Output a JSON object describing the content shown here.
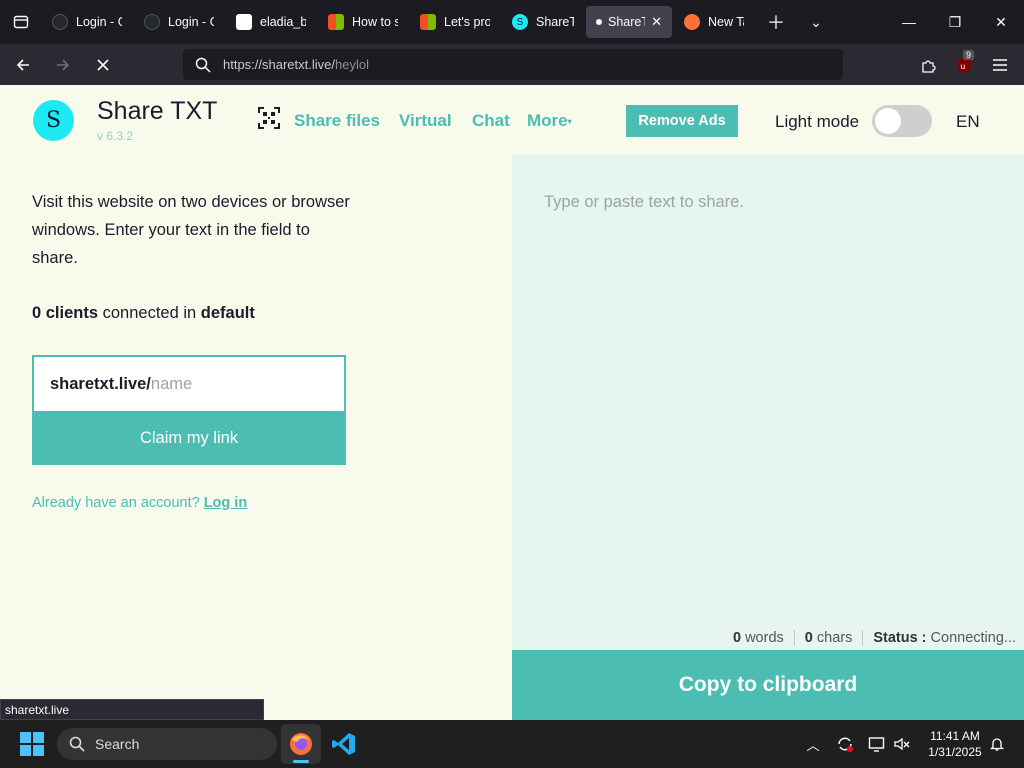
{
  "browser": {
    "tabs": [
      {
        "label": "Login - GitHub",
        "favicon": "github-icon",
        "color": "#24292e"
      },
      {
        "label": "Login - GitHub",
        "favicon": "github-icon",
        "color": "#24292e"
      },
      {
        "label": "eladia_bl",
        "favicon": "doc-icon",
        "color": "#ffffff"
      },
      {
        "label": "How to s",
        "favicon": "microsoft-icon",
        "color": "#f25022"
      },
      {
        "label": "Let's prot",
        "favicon": "microsoft-icon",
        "color": "#f25022"
      },
      {
        "label": "ShareTXT",
        "favicon": "sharetxt-icon",
        "color": "#1de9f2"
      },
      {
        "label": "ShareTXT",
        "favicon": "loading-dot-icon",
        "color": "#fbfbfe"
      },
      {
        "label": "New Tab",
        "favicon": "firefox-icon",
        "color": "#ff7139"
      }
    ],
    "url_prefix": "https://sharetxt.live/",
    "url_path": "heylol",
    "extensions_badge": "9"
  },
  "site": {
    "title": "Share TXT",
    "version": "v 6.3.2",
    "nav": [
      "Share files",
      "Virtual",
      "Chat",
      "More"
    ],
    "remove_ads": "Remove Ads",
    "light_mode_label": "Light mode",
    "light_mode_on": false,
    "language": "EN"
  },
  "left": {
    "intro": "Visit this website on two devices or browser windows. Enter your text in the field to share.",
    "clients_count": "0 clients",
    "clients_mid": " connected in ",
    "clients_room": "default",
    "claim_prefix": "sharetxt.live/",
    "claim_placeholder": "name",
    "claim_button": "Claim my link",
    "account_question": "Already have an account? ",
    "login_link": "Log in"
  },
  "right": {
    "placeholder": "Type or paste text to share.",
    "words_count": "0",
    "words_label": "words",
    "chars_count": "0",
    "chars_label": "chars",
    "status_label": "Status :",
    "status_value": "Connecting...",
    "copy_button": "Copy to clipboard"
  },
  "status_tooltip": "sharetxt.live",
  "taskbar": {
    "search_label": "Search",
    "time": "11:41 AM",
    "date": "1/31/2025"
  },
  "colors": {
    "accent": "#4bbdb3",
    "logo": "#1de9f2",
    "page_bg": "#f8fbec",
    "text_pane_bg": "#e6f6ef"
  }
}
